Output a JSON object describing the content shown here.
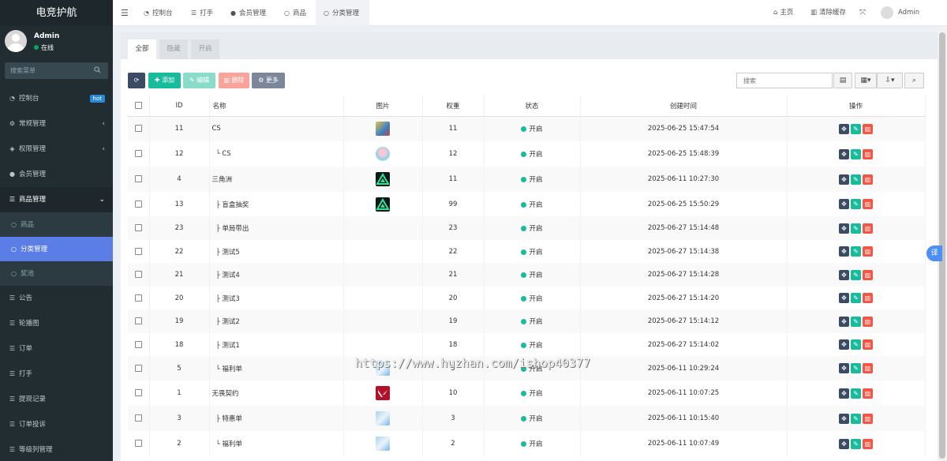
{
  "sidebar": {
    "logo": "电竞护航",
    "user": {
      "name": "Admin",
      "status": "在线"
    },
    "search_placeholder": "搜索菜单",
    "items": [
      {
        "label": "控制台",
        "icon": "dashboard-icon",
        "badge": "hot"
      },
      {
        "label": "常规管理",
        "icon": "cogs-icon",
        "arrow": "‹"
      },
      {
        "label": "权限管理",
        "icon": "group-icon",
        "arrow": "‹"
      },
      {
        "label": "会员管理",
        "icon": "user-icon"
      },
      {
        "label": "商品管理",
        "icon": "list-icon",
        "arrow": "⌄"
      },
      {
        "label": "商品",
        "icon": "circle-icon"
      },
      {
        "label": "分类管理",
        "icon": "circle-icon"
      },
      {
        "label": "奖池",
        "icon": "circle-icon"
      },
      {
        "label": "公告",
        "icon": "list-icon"
      },
      {
        "label": "轮播图",
        "icon": "list-icon"
      },
      {
        "label": "订单",
        "icon": "list-icon"
      },
      {
        "label": "打手",
        "icon": "list-icon"
      },
      {
        "label": "提现记录",
        "icon": "list-icon"
      },
      {
        "label": "订单投诉",
        "icon": "list-icon"
      },
      {
        "label": "等级列管理",
        "icon": "list-icon"
      }
    ]
  },
  "header": {
    "tabs": [
      {
        "label": "控制台",
        "icon": "dashboard-icon"
      },
      {
        "label": "打手",
        "icon": "list-icon"
      },
      {
        "label": "会员管理",
        "icon": "user-icon"
      },
      {
        "label": "商品",
        "icon": "circle-icon"
      },
      {
        "label": "分类管理",
        "icon": "circle-icon"
      }
    ],
    "home": "主页",
    "clear_cache": "清除缓存",
    "admin": "Admin"
  },
  "content": {
    "tabs": [
      "全部",
      "隐藏",
      "开启"
    ],
    "toolbar": {
      "add": "添加",
      "edit": "编辑",
      "delete": "删除",
      "more": "更多",
      "search_placeholder": "搜索"
    },
    "columns": [
      "ID",
      "名称",
      "图片",
      "权重",
      "状态",
      "创建时间",
      "操作"
    ],
    "rows": [
      {
        "id": "11",
        "name": "CS",
        "weight": "11",
        "status": "开启",
        "created": "2025-06-25 15:47:54",
        "thumb": "cs"
      },
      {
        "id": "12",
        "name": "└ CS",
        "weight": "12",
        "status": "开启",
        "created": "2025-06-25 15:48:39",
        "thumb": "anime"
      },
      {
        "id": "4",
        "name": "三角洲",
        "weight": "11",
        "status": "开启",
        "created": "2025-06-11 10:27:30",
        "thumb": "delta"
      },
      {
        "id": "13",
        "name": "├ 盲盒抽奖",
        "weight": "99",
        "status": "开启",
        "created": "2025-06-25 15:50:29",
        "thumb": "delta"
      },
      {
        "id": "23",
        "name": "├ 单局带出",
        "weight": "23",
        "status": "开启",
        "created": "2025-06-27 15:14:48",
        "thumb": ""
      },
      {
        "id": "22",
        "name": "├ 测试5",
        "weight": "22",
        "status": "开启",
        "created": "2025-06-27 15:14:38",
        "thumb": ""
      },
      {
        "id": "21",
        "name": "├ 测试4",
        "weight": "21",
        "status": "开启",
        "created": "2025-06-27 15:14:28",
        "thumb": ""
      },
      {
        "id": "20",
        "name": "├ 测试3",
        "weight": "20",
        "status": "开启",
        "created": "2025-06-27 15:14:20",
        "thumb": ""
      },
      {
        "id": "19",
        "name": "├ 测试2",
        "weight": "19",
        "status": "开启",
        "created": "2025-06-27 15:14:12",
        "thumb": ""
      },
      {
        "id": "18",
        "name": "├ 测试1",
        "weight": "18",
        "status": "开启",
        "created": "2025-06-27 15:14:02",
        "thumb": ""
      },
      {
        "id": "5",
        "name": "└ 福利单",
        "weight": "5",
        "status": "开启",
        "created": "2025-06-11 10:29:24",
        "thumb": "sky"
      },
      {
        "id": "1",
        "name": "无畏契约",
        "weight": "10",
        "status": "开启",
        "created": "2025-06-11 10:07:25",
        "thumb": "valorant"
      },
      {
        "id": "3",
        "name": "├ 特惠单",
        "weight": "3",
        "status": "开启",
        "created": "2025-06-11 10:15:40",
        "thumb": "sky"
      },
      {
        "id": "2",
        "name": "└ 福利单",
        "weight": "2",
        "status": "开启",
        "created": "2025-06-11 10:07:49",
        "thumb": "sky"
      }
    ]
  },
  "watermark": "https://www.huzhan.com/ishop40377",
  "translate_label": "译",
  "colors": {
    "sidebar": "#222d32",
    "active": "#5a7ee6",
    "add": "#18bc9c",
    "delete": "#f75444",
    "dark": "#3c4b64",
    "status": "#18bc9c"
  }
}
